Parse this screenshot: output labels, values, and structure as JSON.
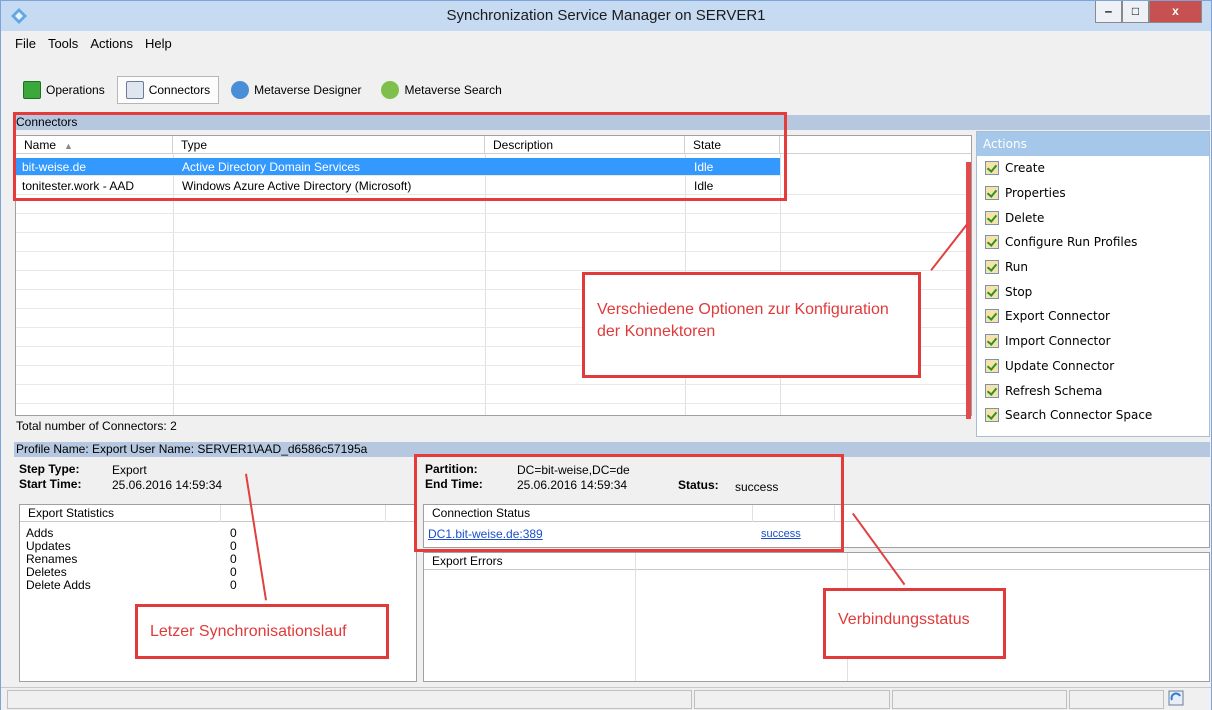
{
  "window": {
    "title": "Synchronization Service Manager on SERVER1",
    "minimize_label": "‒",
    "maximize_label": "□",
    "close_label": "x"
  },
  "menu": [
    "File",
    "Tools",
    "Actions",
    "Help"
  ],
  "toolbar": {
    "operations": "Operations",
    "connectors": "Connectors",
    "metaverse_designer": "Metaverse Designer",
    "metaverse_search": "Metaverse Search"
  },
  "connectors": {
    "section_title": "Connectors",
    "columns": [
      "Name",
      "Type",
      "Description",
      "State"
    ],
    "rows": [
      {
        "name": "bit-weise.de",
        "type": "Active Directory Domain Services",
        "description": "",
        "state": "Idle"
      },
      {
        "name": "tonitester.work - AAD",
        "type": "Windows Azure Active Directory (Microsoft)",
        "description": "",
        "state": "Idle"
      }
    ],
    "total": "Total number of Connectors: 2"
  },
  "actions": {
    "title": "Actions",
    "items": [
      "Create",
      "Properties",
      "Delete",
      "Configure Run Profiles",
      "Run",
      "Stop",
      "Export Connector",
      "Import Connector",
      "Update Connector",
      "Refresh Schema",
      "Search Connector Space"
    ]
  },
  "profile": {
    "header": "Profile Name: Export  User Name: SERVER1\\AAD_d6586c57195a",
    "step_type_label": "Step Type:",
    "step_type": "Export",
    "start_time_label": "Start Time:",
    "start_time": "25.06.2016 14:59:34",
    "partition_label": "Partition:",
    "partition": "DC=bit-weise,DC=de",
    "end_time_label": "End Time:",
    "end_time": "25.06.2016 14:59:34",
    "status_label": "Status:",
    "status": "success"
  },
  "export_statistics": {
    "title": "Export Statistics",
    "rows": [
      {
        "label": "Adds",
        "value": "0"
      },
      {
        "label": "Updates",
        "value": "0"
      },
      {
        "label": "Renames",
        "value": "0"
      },
      {
        "label": "Deletes",
        "value": "0"
      },
      {
        "label": "Delete Adds",
        "value": "0"
      }
    ]
  },
  "connection_status": {
    "title": "Connection Status",
    "server": "DC1.bit-weise.de:389",
    "result": "success"
  },
  "export_errors": {
    "title": "Export Errors"
  },
  "annotations": {
    "options": "Verschiedene Optionen zur Konfiguration der Konnektoren",
    "last_run": "Letzer Synchronisationslauf",
    "connection": "Verbindungsstatus"
  },
  "colors": {
    "annotation": "#e03a3a",
    "selection": "#3399ff",
    "section_bar": "#b6c8e0"
  }
}
